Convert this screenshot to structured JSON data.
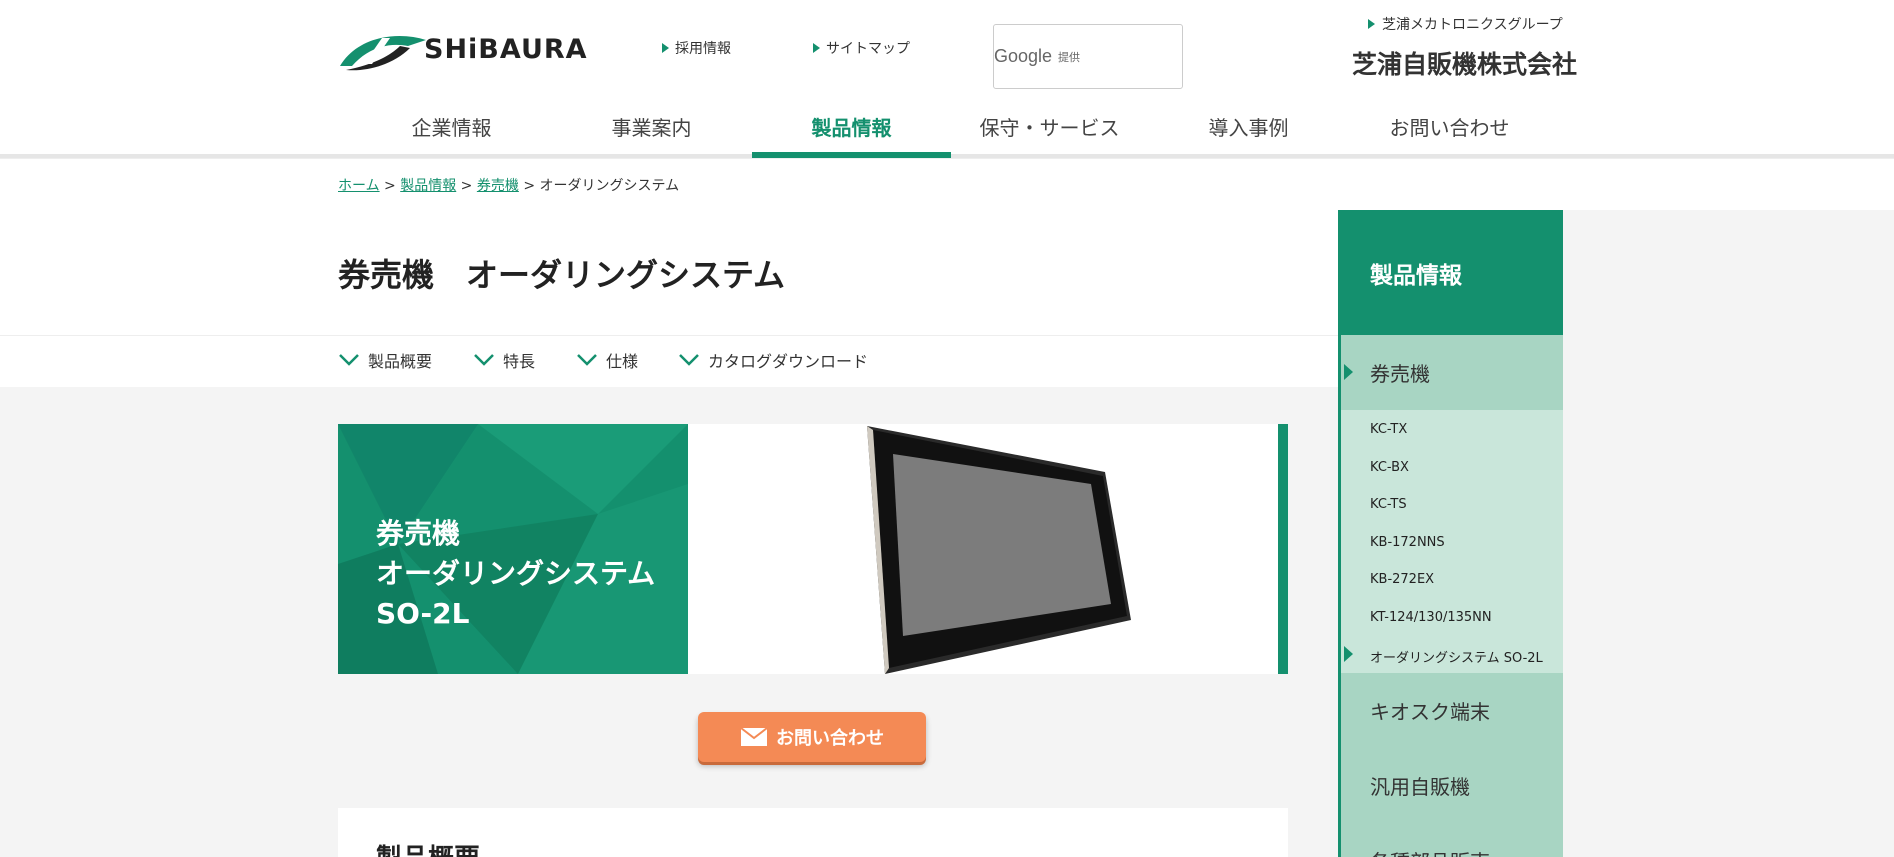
{
  "header": {
    "logo_text": "SHiBAURA",
    "links": [
      "採用情報",
      "サイトマップ"
    ],
    "search_brand": "Google",
    "search_sub": "提供",
    "group_link": "芝浦メカトロニクスグループ",
    "company": "芝浦自販機株式会社"
  },
  "gnav": [
    "企業情報",
    "事業案内",
    "製品情報",
    "保守・サービス",
    "導入事例",
    "お問い合わせ"
  ],
  "gnav_active": "製品情報",
  "breadcrumb": {
    "home": "ホーム",
    "sep1": " > ",
    "products": "製品情報",
    "sep2": " > ",
    "kenbaiki": "券売機",
    "sep3": " > ",
    "current": "オーダリングシステム"
  },
  "page_title": "券売機　オーダリングシステム",
  "subnav": [
    "製品概要",
    "特長",
    "仕様",
    "カタログダウンロード"
  ],
  "hero": {
    "line1": "券売機",
    "line2": "オーダリングシステム",
    "line3": "SO-2L"
  },
  "contact_button": "お問い合わせ",
  "overview_title": "製品概要",
  "sidebar": {
    "title": "製品情報",
    "category_current": "券売機",
    "items": [
      "KC-TX",
      "KC-BX",
      "KC-TS",
      "KB-172NNS",
      "KB-272EX",
      "KT-124/130/135NN",
      "オーダリングシステム SO-2L"
    ],
    "current_item": "オーダリングシステム SO-2L",
    "other_categories": [
      "キオスク端末",
      "汎用自販機",
      "各種部品販売"
    ]
  },
  "colors": {
    "brand_green": "#14906e",
    "side_light": "#a8d5c3",
    "side_lighter": "#c9e6da",
    "contact_orange": "#f48a55"
  }
}
